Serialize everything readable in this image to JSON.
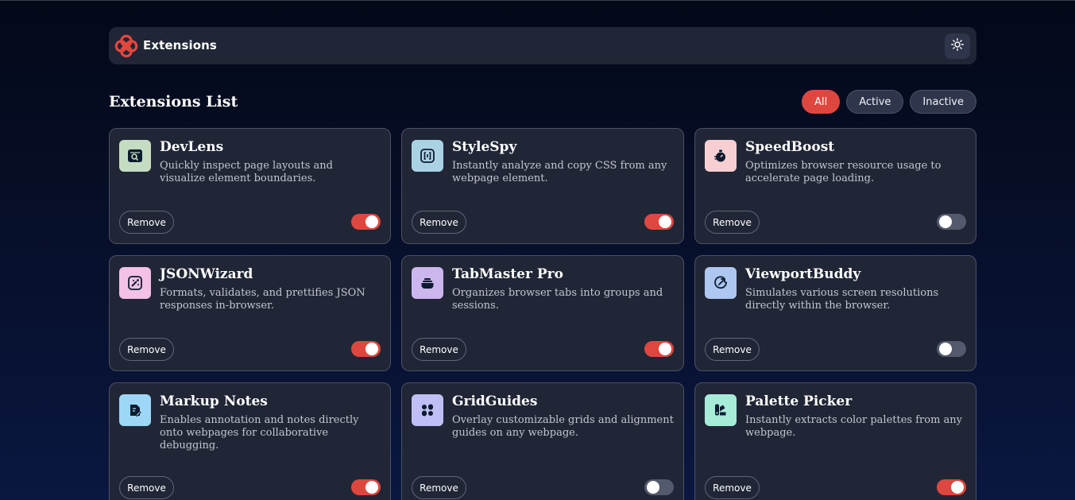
{
  "header": {
    "brand": "Extensions",
    "logo_icon": "extensions-logo-icon",
    "theme_icon": "sun-icon"
  },
  "list": {
    "title": "Extensions List",
    "filters": [
      {
        "label": "All",
        "selected": true
      },
      {
        "label": "Active",
        "selected": false
      },
      {
        "label": "Inactive",
        "selected": false
      }
    ]
  },
  "colors": {
    "accent": "#de473f",
    "card_bg": "#212636",
    "toggle_off": "#545a6d"
  },
  "extensions": [
    {
      "name": "DevLens",
      "description": "Quickly inspect page layouts and visualize element boundaries.",
      "remove_label": "Remove",
      "active": true,
      "icon": "inspect-window-icon",
      "icon_bg": "#c5dcc3"
    },
    {
      "name": "StyleSpy",
      "description": "Instantly analyze and copy CSS from any webpage element.",
      "remove_label": "Remove",
      "active": true,
      "icon": "code-brackets-icon",
      "icon_bg": "#a9d3e5"
    },
    {
      "name": "SpeedBoost",
      "description": "Optimizes browser resource usage to accelerate page loading.",
      "remove_label": "Remove",
      "active": false,
      "icon": "stopwatch-icon",
      "icon_bg": "#f7cfd2"
    },
    {
      "name": "JSONWizard",
      "description": "Formats, validates, and prettifies JSON responses in-browser.",
      "remove_label": "Remove",
      "active": true,
      "icon": "magic-wand-icon",
      "icon_bg": "#f3c0e6"
    },
    {
      "name": "TabMaster Pro",
      "description": "Organizes browser tabs into groups and sessions.",
      "remove_label": "Remove",
      "active": true,
      "icon": "tabs-stack-icon",
      "icon_bg": "#cbb6ee"
    },
    {
      "name": "ViewportBuddy",
      "description": "Simulates various screen resolutions directly within the browser.",
      "remove_label": "Remove",
      "active": false,
      "icon": "viewport-arrow-icon",
      "icon_bg": "#aec7f1"
    },
    {
      "name": "Markup Notes",
      "description": "Enables annotation and notes directly onto webpages for collaborative debugging.",
      "remove_label": "Remove",
      "active": true,
      "icon": "note-pen-icon",
      "icon_bg": "#9ed6f5"
    },
    {
      "name": "GridGuides",
      "description": "Overlay customizable grids and alignment guides on any webpage.",
      "remove_label": "Remove",
      "active": false,
      "icon": "grid-dots-icon",
      "icon_bg": "#c0bff5"
    },
    {
      "name": "Palette Picker",
      "description": "Instantly extracts color palettes from any webpage.",
      "remove_label": "Remove",
      "active": true,
      "icon": "palette-icon",
      "icon_bg": "#a6ecd9"
    }
  ]
}
